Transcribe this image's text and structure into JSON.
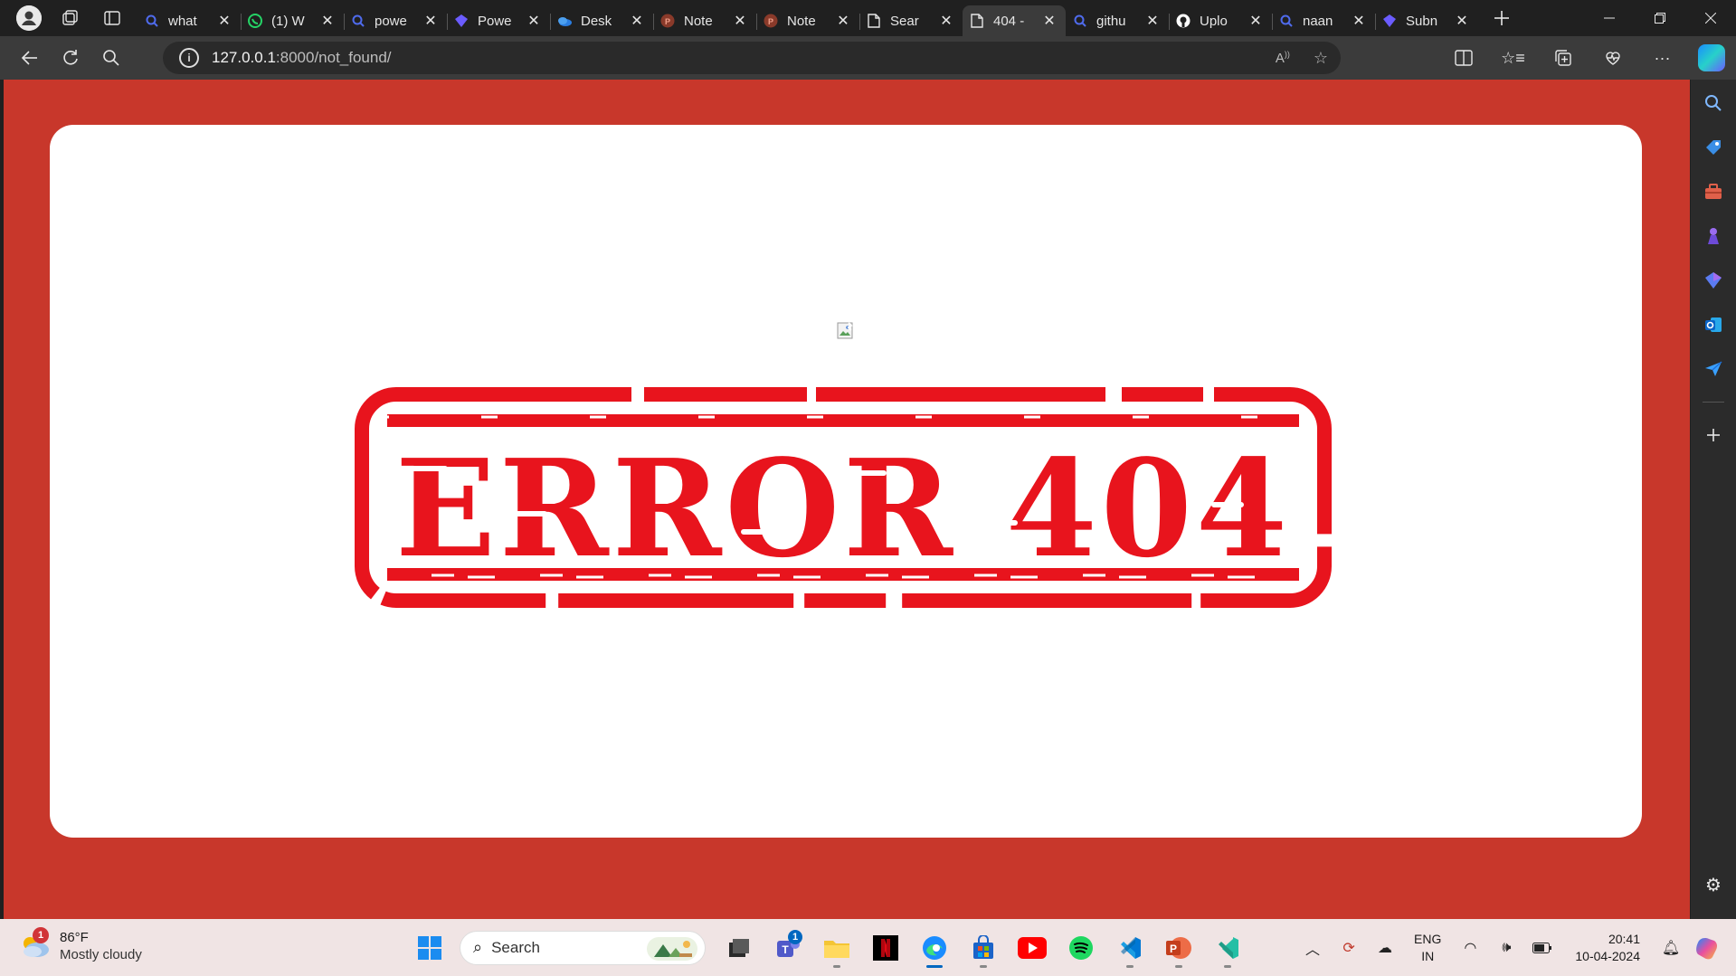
{
  "browser": {
    "tabs": [
      {
        "title": "what",
        "favicon": "search-icon",
        "color": "#4f6bed"
      },
      {
        "title": "(1) W",
        "favicon": "whatsapp-icon",
        "color": "#25d366"
      },
      {
        "title": "powe",
        "favicon": "search-icon",
        "color": "#4f6bed"
      },
      {
        "title": "Powe",
        "favicon": "copilot-icon",
        "color": "#6b5cff"
      },
      {
        "title": "Desk",
        "favicon": "onedrive-icon",
        "color": "#2a7de1"
      },
      {
        "title": "Note",
        "favicon": "powerpoint-icon",
        "color": "#b7472a"
      },
      {
        "title": "Note",
        "favicon": "powerpoint-icon",
        "color": "#b7472a"
      },
      {
        "title": "Sear",
        "favicon": "page-icon",
        "color": "#e6e6e6"
      },
      {
        "title": "404 -",
        "favicon": "page-icon",
        "color": "#e6e6e6",
        "active": true
      },
      {
        "title": "githu",
        "favicon": "search-icon",
        "color": "#4f6bed"
      },
      {
        "title": "Uplo",
        "favicon": "github-icon",
        "color": "#ffffff"
      },
      {
        "title": "naan",
        "favicon": "search-icon",
        "color": "#4f6bed"
      },
      {
        "title": "Subn",
        "favicon": "copilot-icon",
        "color": "#6b5cff"
      }
    ],
    "url_host": "127.0.0.1",
    "url_path": ":8000/not_found/"
  },
  "page": {
    "background": "#c8372b",
    "card_background": "#ffffff",
    "stamp_text": "ERROR 404",
    "stamp_color": "#e8141d",
    "image_alt": ""
  },
  "taskbar": {
    "weather_badge": "1",
    "temperature": "86°F",
    "condition": "Mostly cloudy",
    "search_label": "Search",
    "teams_badge": "1",
    "lang_top": "ENG",
    "lang_bottom": "IN",
    "time": "20:41",
    "date": "10-04-2024"
  }
}
